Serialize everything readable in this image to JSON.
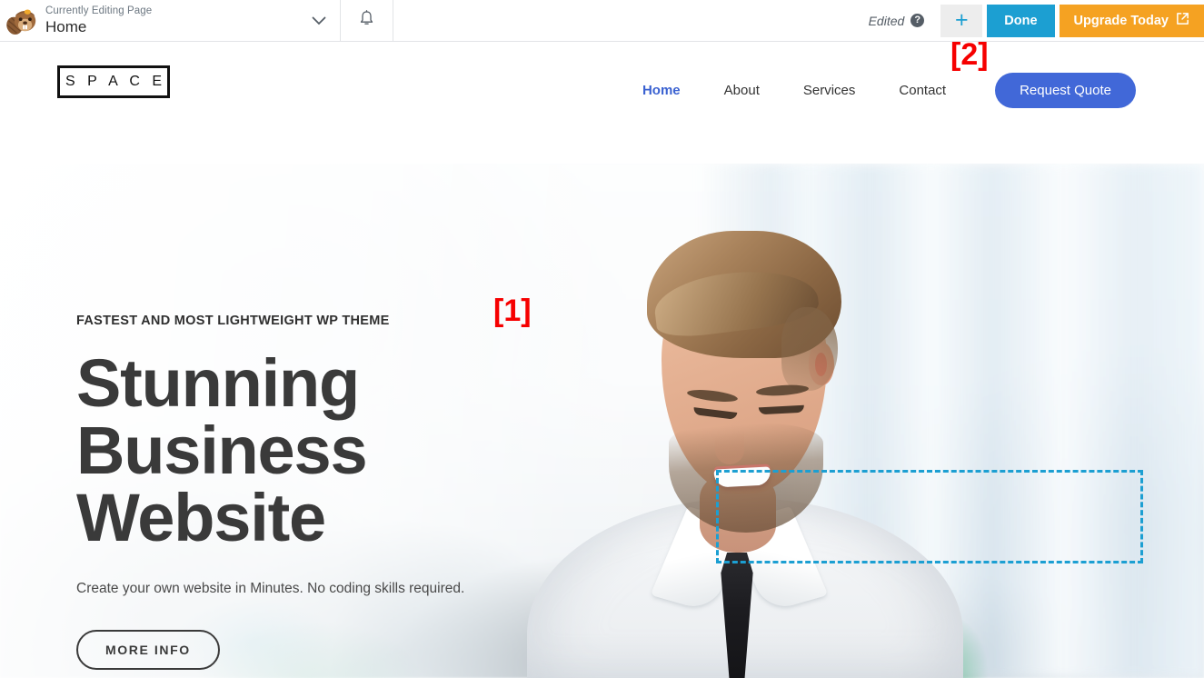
{
  "admin_bar": {
    "logo_icon": "beaver-builder-logo",
    "page_kicker": "Currently Editing Page",
    "page_name": "Home",
    "page_dropdown_icon": "chevron-down-icon",
    "notifications_icon": "bell-icon",
    "edited_label": "Edited",
    "help_icon": "help-circle-icon",
    "help_glyph": "?",
    "add_button_icon": "plus-icon",
    "add_button_glyph": "+",
    "done_label": "Done",
    "upgrade_label": "Upgrade Today",
    "upgrade_icon": "external-link-icon",
    "colors": {
      "done_blue": "#1c9fd2",
      "upgrade_orange": "#f5a222",
      "add_bg": "#ededed"
    }
  },
  "site_header": {
    "logo_text": "S P A C E",
    "nav": [
      {
        "label": "Home",
        "active": true
      },
      {
        "label": "About",
        "active": false
      },
      {
        "label": "Services",
        "active": false
      },
      {
        "label": "Contact",
        "active": false
      }
    ],
    "cta_label": "Request Quote",
    "cta_color": "#4168d8",
    "active_nav_color": "#3b62d1"
  },
  "hero": {
    "kicker": "FASTEST AND MOST LIGHTWEIGHT WP THEME",
    "title_line_1": "Stunning Business",
    "title_line_2": "Website",
    "subtitle": "Create your own website in Minutes. No coding skills required.",
    "button_label": "MORE INFO",
    "image_description": "bearded man in white shirt and black tie smiling and looking down in a blurred office"
  },
  "builder": {
    "selection_outline_color": "#1c9fd2",
    "selection_style": "dashed"
  },
  "annotations": [
    {
      "label": "[1]",
      "color": "#f60000"
    },
    {
      "label": "[2]",
      "color": "#f60000"
    }
  ]
}
